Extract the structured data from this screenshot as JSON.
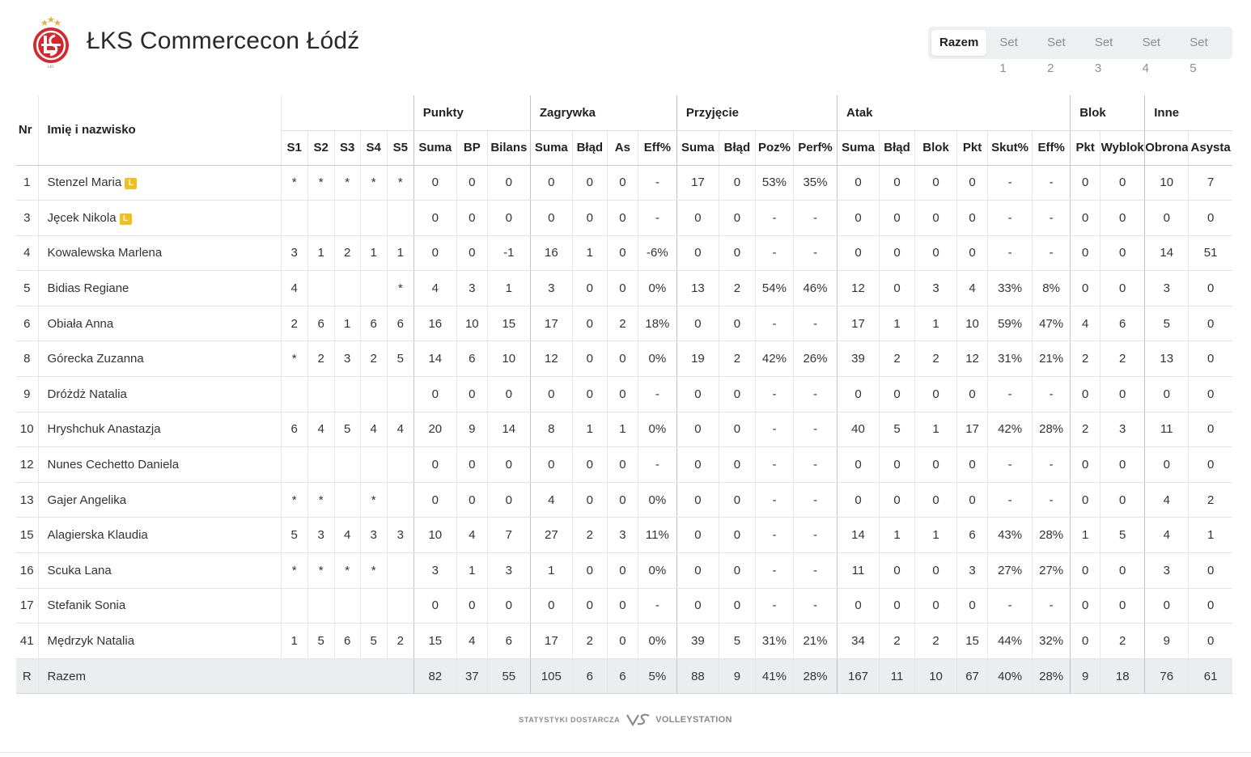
{
  "header": {
    "team_name": "ŁKS Commercecon Łódź",
    "logo_icon": "lks-club-crest"
  },
  "tabs": [
    {
      "label": "Razem",
      "active": true
    },
    {
      "label": "Set 1",
      "active": false
    },
    {
      "label": "Set 2",
      "active": false
    },
    {
      "label": "Set 3",
      "active": false
    },
    {
      "label": "Set 4",
      "active": false
    },
    {
      "label": "Set 5",
      "active": false
    }
  ],
  "table": {
    "head": {
      "nr": "Nr",
      "name": "Imię i nazwisko",
      "groups": {
        "punkty": "Punkty",
        "zagrywka": "Zagrywka",
        "przyjecie": "Przyjęcie",
        "atak": "Atak",
        "blok": "Blok",
        "inne": "Inne"
      },
      "columns": [
        "S1",
        "S2",
        "S3",
        "S4",
        "S5",
        "Suma",
        "BP",
        "Bilans",
        "Suma",
        "Błąd",
        "As",
        "Eff%",
        "Suma",
        "Błąd",
        "Poz%",
        "Perf%",
        "Suma",
        "Błąd",
        "Blok",
        "Pkt",
        "Skut%",
        "Eff%",
        "Pkt",
        "Wyblok",
        "Obrona",
        "Asysta"
      ]
    },
    "libero_badge": "L",
    "rows": [
      {
        "nr": "1",
        "name": "Stenzel Maria",
        "libero": true,
        "cells": [
          "*",
          "*",
          "*",
          "*",
          "*",
          "0",
          "0",
          "0",
          "0",
          "0",
          "0",
          "-",
          "17",
          "0",
          "53%",
          "35%",
          "0",
          "0",
          "0",
          "0",
          "-",
          "-",
          "0",
          "0",
          "10",
          "7"
        ]
      },
      {
        "nr": "3",
        "name": "Jęcek Nikola",
        "libero": true,
        "cells": [
          "",
          "",
          "",
          "",
          "",
          "0",
          "0",
          "0",
          "0",
          "0",
          "0",
          "-",
          "0",
          "0",
          "-",
          "-",
          "0",
          "0",
          "0",
          "0",
          "-",
          "-",
          "0",
          "0",
          "0",
          "0"
        ]
      },
      {
        "nr": "4",
        "name": "Kowalewska Marlena",
        "libero": false,
        "cells": [
          "3",
          "1",
          "2",
          "1",
          "1",
          "0",
          "0",
          "-1",
          "16",
          "1",
          "0",
          "-6%",
          "0",
          "0",
          "-",
          "-",
          "0",
          "0",
          "0",
          "0",
          "-",
          "-",
          "0",
          "0",
          "14",
          "51"
        ]
      },
      {
        "nr": "5",
        "name": "Bidias Regiane",
        "libero": false,
        "cells": [
          "4",
          "",
          "",
          "",
          "*",
          "4",
          "3",
          "1",
          "3",
          "0",
          "0",
          "0%",
          "13",
          "2",
          "54%",
          "46%",
          "12",
          "0",
          "3",
          "4",
          "33%",
          "8%",
          "0",
          "0",
          "3",
          "0"
        ]
      },
      {
        "nr": "6",
        "name": "Obiała Anna",
        "libero": false,
        "cells": [
          "2",
          "6",
          "1",
          "6",
          "6",
          "16",
          "10",
          "15",
          "17",
          "0",
          "2",
          "18%",
          "0",
          "0",
          "-",
          "-",
          "17",
          "1",
          "1",
          "10",
          "59%",
          "47%",
          "4",
          "6",
          "5",
          "0"
        ]
      },
      {
        "nr": "8",
        "name": "Górecka Zuzanna",
        "libero": false,
        "cells": [
          "*",
          "2",
          "3",
          "2",
          "5",
          "14",
          "6",
          "10",
          "12",
          "0",
          "0",
          "0%",
          "19",
          "2",
          "42%",
          "26%",
          "39",
          "2",
          "2",
          "12",
          "31%",
          "21%",
          "2",
          "2",
          "13",
          "0"
        ]
      },
      {
        "nr": "9",
        "name": "Dróżdż Natalia",
        "libero": false,
        "cells": [
          "",
          "",
          "",
          "",
          "",
          "0",
          "0",
          "0",
          "0",
          "0",
          "0",
          "-",
          "0",
          "0",
          "-",
          "-",
          "0",
          "0",
          "0",
          "0",
          "-",
          "-",
          "0",
          "0",
          "0",
          "0"
        ]
      },
      {
        "nr": "10",
        "name": "Hryshchuk Anastazja",
        "libero": false,
        "cells": [
          "6",
          "4",
          "5",
          "4",
          "4",
          "20",
          "9",
          "14",
          "8",
          "1",
          "1",
          "0%",
          "0",
          "0",
          "-",
          "-",
          "40",
          "5",
          "1",
          "17",
          "42%",
          "28%",
          "2",
          "3",
          "11",
          "0"
        ]
      },
      {
        "nr": "12",
        "name": "Nunes Cechetto Daniela",
        "libero": false,
        "cells": [
          "",
          "",
          "",
          "",
          "",
          "0",
          "0",
          "0",
          "0",
          "0",
          "0",
          "-",
          "0",
          "0",
          "-",
          "-",
          "0",
          "0",
          "0",
          "0",
          "-",
          "-",
          "0",
          "0",
          "0",
          "0"
        ]
      },
      {
        "nr": "13",
        "name": "Gajer Angelika",
        "libero": false,
        "cells": [
          "*",
          "*",
          "",
          "*",
          "",
          "0",
          "0",
          "0",
          "4",
          "0",
          "0",
          "0%",
          "0",
          "0",
          "-",
          "-",
          "0",
          "0",
          "0",
          "0",
          "-",
          "-",
          "0",
          "0",
          "4",
          "2"
        ]
      },
      {
        "nr": "15",
        "name": "Alagierska Klaudia",
        "libero": false,
        "cells": [
          "5",
          "3",
          "4",
          "3",
          "3",
          "10",
          "4",
          "7",
          "27",
          "2",
          "3",
          "11%",
          "0",
          "0",
          "-",
          "-",
          "14",
          "1",
          "1",
          "6",
          "43%",
          "28%",
          "1",
          "5",
          "4",
          "1"
        ]
      },
      {
        "nr": "16",
        "name": "Scuka Lana",
        "libero": false,
        "cells": [
          "*",
          "*",
          "*",
          "*",
          "",
          "3",
          "1",
          "3",
          "1",
          "0",
          "0",
          "0%",
          "0",
          "0",
          "-",
          "-",
          "11",
          "0",
          "0",
          "3",
          "27%",
          "27%",
          "0",
          "0",
          "3",
          "0"
        ]
      },
      {
        "nr": "17",
        "name": "Stefanik Sonia",
        "libero": false,
        "cells": [
          "",
          "",
          "",
          "",
          "",
          "0",
          "0",
          "0",
          "0",
          "0",
          "0",
          "-",
          "0",
          "0",
          "-",
          "-",
          "0",
          "0",
          "0",
          "0",
          "-",
          "-",
          "0",
          "0",
          "0",
          "0"
        ]
      },
      {
        "nr": "41",
        "name": "Mędrzyk Natalia",
        "libero": false,
        "cells": [
          "1",
          "5",
          "6",
          "5",
          "2",
          "15",
          "4",
          "6",
          "17",
          "2",
          "0",
          "0%",
          "39",
          "5",
          "31%",
          "21%",
          "34",
          "2",
          "2",
          "15",
          "44%",
          "32%",
          "0",
          "2",
          "9",
          "0"
        ]
      }
    ],
    "total": {
      "nr": "R",
      "name": "Razem",
      "cells": [
        "82",
        "37",
        "55",
        "105",
        "6",
        "6",
        "5%",
        "88",
        "9",
        "41%",
        "28%",
        "167",
        "11",
        "10",
        "67",
        "40%",
        "28%",
        "9",
        "18",
        "76",
        "61"
      ]
    }
  },
  "footer": {
    "provided_by": "STATYSTYKI DOSTARCZA",
    "brand": "VOLLEYSTATION",
    "brand_icon": "volleystation-logo-icon"
  }
}
